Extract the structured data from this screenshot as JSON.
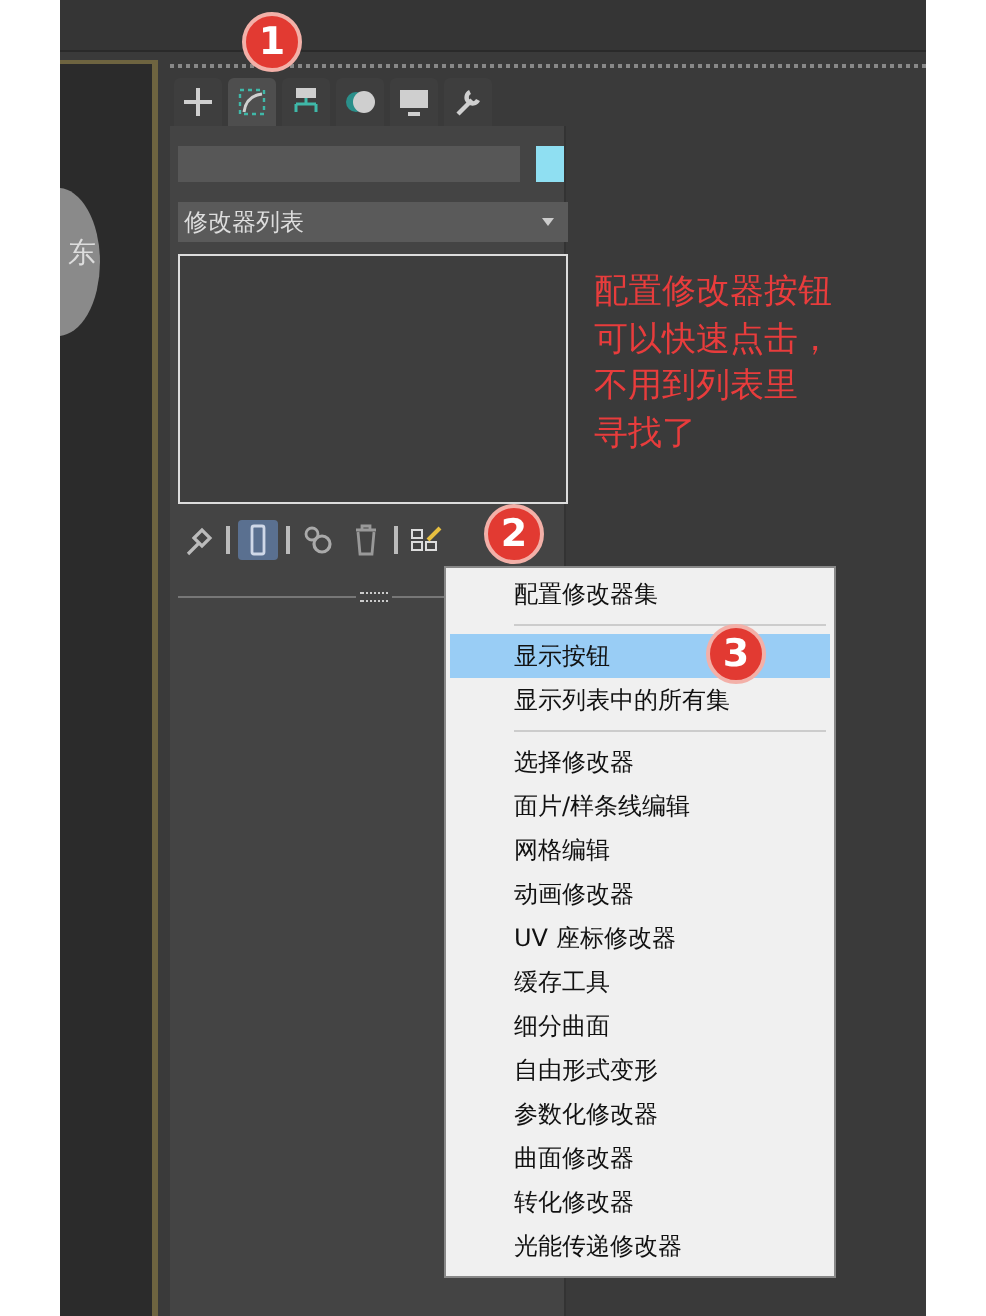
{
  "viewport": {
    "viewcube_label": "东"
  },
  "command_panel": {
    "tabs": [
      {
        "kind": "create",
        "selected": false
      },
      {
        "kind": "modify",
        "selected": true
      },
      {
        "kind": "hierarchy",
        "selected": false
      },
      {
        "kind": "motion",
        "selected": false
      },
      {
        "kind": "display",
        "selected": false
      },
      {
        "kind": "utilities",
        "selected": false
      }
    ],
    "modifier_list": {
      "label": "修改器列表"
    },
    "stack_tools": [
      {
        "kind": "pin",
        "on": false
      },
      {
        "kind": "end_result",
        "on": true
      },
      {
        "kind": "unique",
        "on": false
      },
      {
        "kind": "remove",
        "on": false
      },
      {
        "kind": "configure",
        "on": false
      }
    ]
  },
  "note": {
    "lines": [
      "配置修改器按钮",
      "可以快速点击，",
      "不用到列表里",
      "寻找了"
    ]
  },
  "markers": [
    {
      "number": "1",
      "kind": "tab"
    },
    {
      "number": "2",
      "kind": "configure"
    },
    {
      "number": "3",
      "kind": "menu"
    }
  ],
  "context_menu": {
    "items": [
      {
        "kind": "item",
        "label": "配置修改器集",
        "selected": false
      },
      {
        "kind": "separator"
      },
      {
        "kind": "item",
        "label": "显示按钮",
        "selected": true
      },
      {
        "kind": "item",
        "label": "显示列表中的所有集",
        "selected": false
      },
      {
        "kind": "separator"
      },
      {
        "kind": "item",
        "label": "选择修改器",
        "selected": false
      },
      {
        "kind": "item",
        "label": "面片/样条线编辑",
        "selected": false
      },
      {
        "kind": "item",
        "label": "网格编辑",
        "selected": false
      },
      {
        "kind": "item",
        "label": "动画修改器",
        "selected": false
      },
      {
        "kind": "item",
        "label": "UV 座标修改器",
        "selected": false
      },
      {
        "kind": "item",
        "label": "缓存工具",
        "selected": false
      },
      {
        "kind": "item",
        "label": "细分曲面",
        "selected": false
      },
      {
        "kind": "item",
        "label": "自由形式变形",
        "selected": false
      },
      {
        "kind": "item",
        "label": "参数化修改器",
        "selected": false
      },
      {
        "kind": "item",
        "label": "曲面修改器",
        "selected": false
      },
      {
        "kind": "item",
        "label": "转化修改器",
        "selected": false
      },
      {
        "kind": "item",
        "label": "光能传递修改器",
        "selected": false
      }
    ]
  }
}
